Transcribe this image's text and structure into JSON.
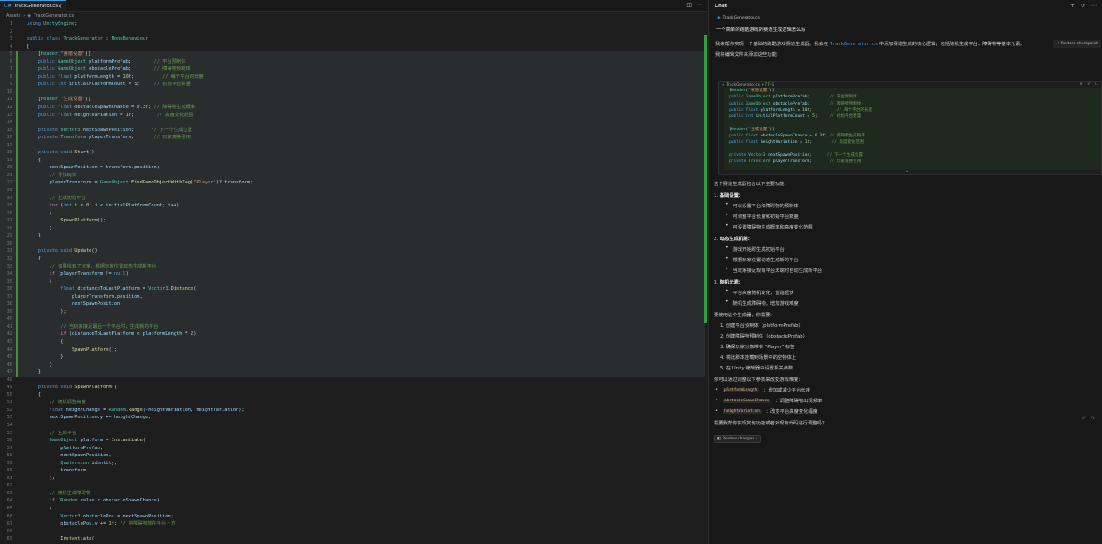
{
  "editor": {
    "tab_label": "TrackGenerator.cs",
    "tab_icon": "C#",
    "breadcrumb": [
      "Assets",
      "TrackGenerator.cs"
    ]
  },
  "code_lines": [
    [
      {
        "t": "using ",
        "c": "kw"
      },
      {
        "t": "UnityEngine",
        "c": "ty"
      },
      {
        "t": ";",
        "c": ""
      }
    ],
    [],
    [
      {
        "t": "public class ",
        "c": "kw"
      },
      {
        "t": "TrackGenerator",
        "c": "ty"
      },
      {
        "t": " : ",
        "c": ""
      },
      {
        "t": "MonoBehaviour",
        "c": "ty"
      }
    ],
    [
      {
        "t": "{",
        "c": ""
      }
    ],
    [
      {
        "t": "    [",
        "c": ""
      },
      {
        "t": "Header",
        "c": "ty"
      },
      {
        "t": "(",
        "c": ""
      },
      {
        "t": "\"赛道设置\"",
        "c": "st"
      },
      {
        "t": ")]",
        "c": ""
      }
    ],
    [
      {
        "t": "    public ",
        "c": "kw"
      },
      {
        "t": "GameObject",
        "c": "ty"
      },
      {
        "t": " platformPrefab;        ",
        "c": "va"
      },
      {
        "t": "// 平台预制体",
        "c": "cm"
      }
    ],
    [
      {
        "t": "    public ",
        "c": "kw"
      },
      {
        "t": "GameObject",
        "c": "ty"
      },
      {
        "t": " obstaclePrefab;        ",
        "c": "va"
      },
      {
        "t": "// 障碍物预制体",
        "c": "cm"
      }
    ],
    [
      {
        "t": "    public float ",
        "c": "kw"
      },
      {
        "t": "platformLength = ",
        "c": "va"
      },
      {
        "t": "10f",
        "c": "nu"
      },
      {
        "t": ";          ",
        "c": ""
      },
      {
        "t": "// 每个平台的长度",
        "c": "cm"
      }
    ],
    [
      {
        "t": "    public int ",
        "c": "kw"
      },
      {
        "t": "initialPlatformCount = ",
        "c": "va"
      },
      {
        "t": "5",
        "c": "nu"
      },
      {
        "t": ";     ",
        "c": ""
      },
      {
        "t": "// 初始平台数量",
        "c": "cm"
      }
    ],
    [],
    [
      {
        "t": "    [",
        "c": ""
      },
      {
        "t": "Header",
        "c": "ty"
      },
      {
        "t": "(",
        "c": ""
      },
      {
        "t": "\"生成设置\"",
        "c": "st"
      },
      {
        "t": ")]",
        "c": ""
      }
    ],
    [
      {
        "t": "    public float ",
        "c": "kw"
      },
      {
        "t": "obstacleSpawnChance = ",
        "c": "va"
      },
      {
        "t": "0.3f",
        "c": "nu"
      },
      {
        "t": "; ",
        "c": ""
      },
      {
        "t": "// 障碍物生成概率",
        "c": "cm"
      }
    ],
    [
      {
        "t": "    public float ",
        "c": "kw"
      },
      {
        "t": "heightVariation = ",
        "c": "va"
      },
      {
        "t": "1f",
        "c": "nu"
      },
      {
        "t": ";        ",
        "c": ""
      },
      {
        "t": "// 高度变化范围",
        "c": "cm"
      }
    ],
    [],
    [
      {
        "t": "    private ",
        "c": "kw"
      },
      {
        "t": "Vector3",
        "c": "ty"
      },
      {
        "t": " nextSpawnPosition;      ",
        "c": "va"
      },
      {
        "t": "// 下一个生成位置",
        "c": "cm"
      }
    ],
    [
      {
        "t": "    private ",
        "c": "kw"
      },
      {
        "t": "Transform",
        "c": "ty"
      },
      {
        "t": " playerTransform;       ",
        "c": "va"
      },
      {
        "t": "// 玩家变换引用",
        "c": "cm"
      }
    ],
    [],
    [
      {
        "t": "    private void ",
        "c": "kw"
      },
      {
        "t": "Start",
        "c": "fn"
      },
      {
        "t": "()",
        "c": ""
      }
    ],
    [
      {
        "t": "    {",
        "c": ""
      }
    ],
    [
      {
        "t": "        nextSpawnPosition = transform.position;",
        "c": "va"
      }
    ],
    [
      {
        "t": "        // 寻找玩家",
        "c": "cm"
      }
    ],
    [
      {
        "t": "        playerTransform = ",
        "c": "va"
      },
      {
        "t": "GameObject",
        "c": "ty"
      },
      {
        "t": ".",
        "c": ""
      },
      {
        "t": "FindGameObjectWithTag",
        "c": "fn"
      },
      {
        "t": "(",
        "c": ""
      },
      {
        "t": "\"Player\"",
        "c": "st"
      },
      {
        "t": ")?.transform;",
        "c": ""
      }
    ],
    [],
    [
      {
        "t": "        // 生成初始平台",
        "c": "cm"
      }
    ],
    [
      {
        "t": "        for ",
        "c": "ctl"
      },
      {
        "t": "(",
        "c": ""
      },
      {
        "t": "int ",
        "c": "kw"
      },
      {
        "t": "i = ",
        "c": "va"
      },
      {
        "t": "0",
        "c": "nu"
      },
      {
        "t": "; i < initialPlatformCount; i++)",
        "c": "va"
      }
    ],
    [
      {
        "t": "        {",
        "c": ""
      }
    ],
    [
      {
        "t": "            ",
        "c": ""
      },
      {
        "t": "SpawnPlatform",
        "c": "fn"
      },
      {
        "t": "();",
        "c": ""
      }
    ],
    [
      {
        "t": "        }",
        "c": ""
      }
    ],
    [
      {
        "t": "    }",
        "c": ""
      }
    ],
    [],
    [
      {
        "t": "    private void ",
        "c": "kw"
      },
      {
        "t": "Update",
        "c": "fn"
      },
      {
        "t": "()",
        "c": ""
      }
    ],
    [
      {
        "t": "    {",
        "c": ""
      }
    ],
    [
      {
        "t": "        // 如果找到了玩家，根据玩家位置动态生成新平台",
        "c": "cm"
      }
    ],
    [
      {
        "t": "        if ",
        "c": "ctl"
      },
      {
        "t": "(playerTransform != ",
        "c": "va"
      },
      {
        "t": "null",
        "c": "kw"
      },
      {
        "t": ")",
        "c": ""
      }
    ],
    [
      {
        "t": "        {",
        "c": ""
      }
    ],
    [
      {
        "t": "            float ",
        "c": "kw"
      },
      {
        "t": "distanceToLastPlatform = ",
        "c": "va"
      },
      {
        "t": "Vector3",
        "c": "ty"
      },
      {
        "t": ".",
        "c": ""
      },
      {
        "t": "Distance",
        "c": "fn"
      },
      {
        "t": "(",
        "c": ""
      }
    ],
    [
      {
        "t": "                playerTransform.position,",
        "c": "va"
      }
    ],
    [
      {
        "t": "                nextSpawnPosition",
        "c": "va"
      }
    ],
    [
      {
        "t": "            );",
        "c": ""
      }
    ],
    [],
    [
      {
        "t": "            // 当玩家接近最后一个平台时，生成新的平台",
        "c": "cm"
      }
    ],
    [
      {
        "t": "            if ",
        "c": "ctl"
      },
      {
        "t": "(distanceToLastPlatform < platformLength * ",
        "c": "va"
      },
      {
        "t": "2",
        "c": "nu"
      },
      {
        "t": ")",
        "c": ""
      }
    ],
    [
      {
        "t": "            {",
        "c": ""
      }
    ],
    [
      {
        "t": "                ",
        "c": ""
      },
      {
        "t": "SpawnPlatform",
        "c": "fn"
      },
      {
        "t": "();",
        "c": ""
      }
    ],
    [
      {
        "t": "            }",
        "c": ""
      }
    ],
    [
      {
        "t": "        }",
        "c": ""
      }
    ],
    [
      {
        "t": "    }",
        "c": ""
      }
    ],
    [],
    [
      {
        "t": "    private void ",
        "c": "kw"
      },
      {
        "t": "SpawnPlatform",
        "c": "fn"
      },
      {
        "t": "()",
        "c": ""
      }
    ],
    [
      {
        "t": "    {",
        "c": ""
      }
    ],
    [
      {
        "t": "        // 随机调整高度",
        "c": "cm"
      }
    ],
    [
      {
        "t": "        float ",
        "c": "kw"
      },
      {
        "t": "heightChange = ",
        "c": "va"
      },
      {
        "t": "Random",
        "c": "ty"
      },
      {
        "t": ".",
        "c": ""
      },
      {
        "t": "Range",
        "c": "fn"
      },
      {
        "t": "(-heightVariation, heightVariation);",
        "c": "va"
      }
    ],
    [
      {
        "t": "        nextSpawnPosition.y += heightChange;",
        "c": "va"
      }
    ],
    [],
    [
      {
        "t": "        // 生成平台",
        "c": "cm"
      }
    ],
    [
      {
        "t": "        ",
        "c": ""
      },
      {
        "t": "GameObject",
        "c": "ty"
      },
      {
        "t": " platform = ",
        "c": "va"
      },
      {
        "t": "Instantiate",
        "c": "fn"
      },
      {
        "t": "(",
        "c": ""
      }
    ],
    [
      {
        "t": "            platformPrefab,",
        "c": "va"
      }
    ],
    [
      {
        "t": "            nextSpawnPosition,",
        "c": "va"
      }
    ],
    [
      {
        "t": "            ",
        "c": ""
      },
      {
        "t": "Quaternion",
        "c": "ty"
      },
      {
        "t": ".identity,",
        "c": "va"
      }
    ],
    [
      {
        "t": "            transform",
        "c": "va"
      }
    ],
    [
      {
        "t": "        );",
        "c": ""
      }
    ],
    [],
    [
      {
        "t": "        // 随机生成障碍物",
        "c": "cm"
      }
    ],
    [
      {
        "t": "        if ",
        "c": "ctl"
      },
      {
        "t": "(",
        "c": ""
      },
      {
        "t": "Random",
        "c": "ty"
      },
      {
        "t": ".value < obstacleSpawnChance)",
        "c": "va"
      }
    ],
    [
      {
        "t": "        {",
        "c": ""
      }
    ],
    [
      {
        "t": "            ",
        "c": ""
      },
      {
        "t": "Vector3",
        "c": "ty"
      },
      {
        "t": " obstaclePos = nextSpawnPosition;",
        "c": "va"
      }
    ],
    [
      {
        "t": "            obstaclePos.y += ",
        "c": "va"
      },
      {
        "t": "1f",
        "c": "nu"
      },
      {
        "t": "; ",
        "c": ""
      },
      {
        "t": "// 将障碍物放在平台上方",
        "c": "cm"
      }
    ],
    [],
    [
      {
        "t": "            ",
        "c": ""
      },
      {
        "t": "Instantiate",
        "c": "fn"
      },
      {
        "t": "(",
        "c": ""
      }
    ]
  ],
  "chat": {
    "title": "Chat",
    "attachment": "TrackGenerator.cs",
    "user_question": "一个简单的跑酷游戏的赛道生成逻辑怎么写",
    "restore_label": "Restore checkpoint",
    "intro_a": "我来帮你实现一个基础的跑酷游戏赛道生成器。我会在 ",
    "intro_link": "TrackGenerator.cs",
    "intro_b": " 中添加赛道生成的核心逻辑，包括随机生成平台、障碍物等基本元素。",
    "intro_2": "我将编辑文件来添加这些功能：",
    "codeblock": {
      "file": "TrackGenerator.cs",
      "diff": "+77 -1",
      "lines": [
        [
          {
            "t": "[",
            "c": ""
          },
          {
            "t": "Header",
            "c": "ty"
          },
          {
            "t": "(",
            "c": ""
          },
          {
            "t": "\"赛道设置\"",
            "c": "st"
          },
          {
            "t": ")]",
            "c": ""
          }
        ],
        [
          {
            "t": "public ",
            "c": "kw"
          },
          {
            "t": "GameObject",
            "c": "ty"
          },
          {
            "t": " platformPrefab;        ",
            "c": "va"
          },
          {
            "t": "// 平台预制体",
            "c": "cm"
          }
        ],
        [
          {
            "t": "public ",
            "c": "kw"
          },
          {
            "t": "GameObject",
            "c": "ty"
          },
          {
            "t": " obstaclePrefab;        ",
            "c": "va"
          },
          {
            "t": "// 障碍物预制体",
            "c": "cm"
          }
        ],
        [
          {
            "t": "public float ",
            "c": "kw"
          },
          {
            "t": "platformLength = ",
            "c": "va"
          },
          {
            "t": "10f",
            "c": "nu"
          },
          {
            "t": ";          ",
            "c": ""
          },
          {
            "t": "// 每个平台的长度",
            "c": "cm"
          }
        ],
        [
          {
            "t": "public int ",
            "c": "kw"
          },
          {
            "t": "initialPlatformCount = ",
            "c": "va"
          },
          {
            "t": "5",
            "c": "nu"
          },
          {
            "t": ";     ",
            "c": ""
          },
          {
            "t": "// 初始平台数量",
            "c": "cm"
          }
        ],
        [],
        [
          {
            "t": "[",
            "c": ""
          },
          {
            "t": "Header",
            "c": "ty"
          },
          {
            "t": "(",
            "c": ""
          },
          {
            "t": "\"生成设置\"",
            "c": "st"
          },
          {
            "t": ")]",
            "c": ""
          }
        ],
        [
          {
            "t": "public float ",
            "c": "kw"
          },
          {
            "t": "obstacleSpawnChance = ",
            "c": "va"
          },
          {
            "t": "0.3f",
            "c": "nu"
          },
          {
            "t": "; ",
            "c": ""
          },
          {
            "t": "// 障碍物生成概率",
            "c": "cm"
          }
        ],
        [
          {
            "t": "public float ",
            "c": "kw"
          },
          {
            "t": "heightVariation = ",
            "c": "va"
          },
          {
            "t": "1f",
            "c": "nu"
          },
          {
            "t": ";        ",
            "c": ""
          },
          {
            "t": "// 高度变化范围",
            "c": "cm"
          }
        ],
        [],
        [
          {
            "t": "private ",
            "c": "kw"
          },
          {
            "t": "Vector3",
            "c": "ty"
          },
          {
            "t": " nextSpawnPosition;      ",
            "c": "va"
          },
          {
            "t": "// 下一个生成位置",
            "c": "cm"
          }
        ],
        [
          {
            "t": "private ",
            "c": "kw"
          },
          {
            "t": "Transform",
            "c": "ty"
          },
          {
            "t": " playerTransform;       ",
            "c": "va"
          },
          {
            "t": "// 玩家变换引用",
            "c": "cm"
          }
        ]
      ]
    },
    "summary_intro": "这个赛道生成器包含以下主要功能：",
    "sections": [
      {
        "num": "1.",
        "title": "基础设置",
        "items": [
          "可以设置平台和障碍物的预制体",
          "可调整平台长度和初始平台数量",
          "可设置障碍物生成概率和高度变化范围"
        ]
      },
      {
        "num": "2.",
        "title": "动态生成机制",
        "items": [
          "游戏开始时生成初始平台",
          "根据玩家位置动态生成新的平台",
          "当玩家接近现有平台末端时自动生成新平台"
        ]
      },
      {
        "num": "3.",
        "title": "随机元素",
        "items": [
          "平台高度随机变化，创造起伏",
          "随机生成障碍物，增加游戏难度"
        ]
      }
    ],
    "usage_intro": "要使用这个生成器，你需要：",
    "steps": [
      "1. 创建平台预制体（platformPrefab）",
      "2. 创建障碍物预制体（obstaclePrefab）",
      "3. 确保玩家对象带有 \"Player\" 标签",
      "4. 将此脚本挂载到场景中的空物体上",
      "5. 在 Unity 编辑器中设置相关参数"
    ],
    "params_intro": "你可以通过调整以下参数来改变游戏难度：",
    "params": [
      {
        "name": "platformLength",
        "desc": "：增加或减少平台长度"
      },
      {
        "name": "obstacleSpawnChance",
        "desc": "：调整障碍物出现频率"
      },
      {
        "name": "heightVariation",
        "desc": "：改变平台高度变化幅度"
      }
    ],
    "closing": "需要我帮你实现其他功能或者对现有代码进行调整吗？",
    "review_label": "Review changes"
  },
  "colors": {
    "accent": "#3794ff",
    "added": "#2ea043"
  }
}
